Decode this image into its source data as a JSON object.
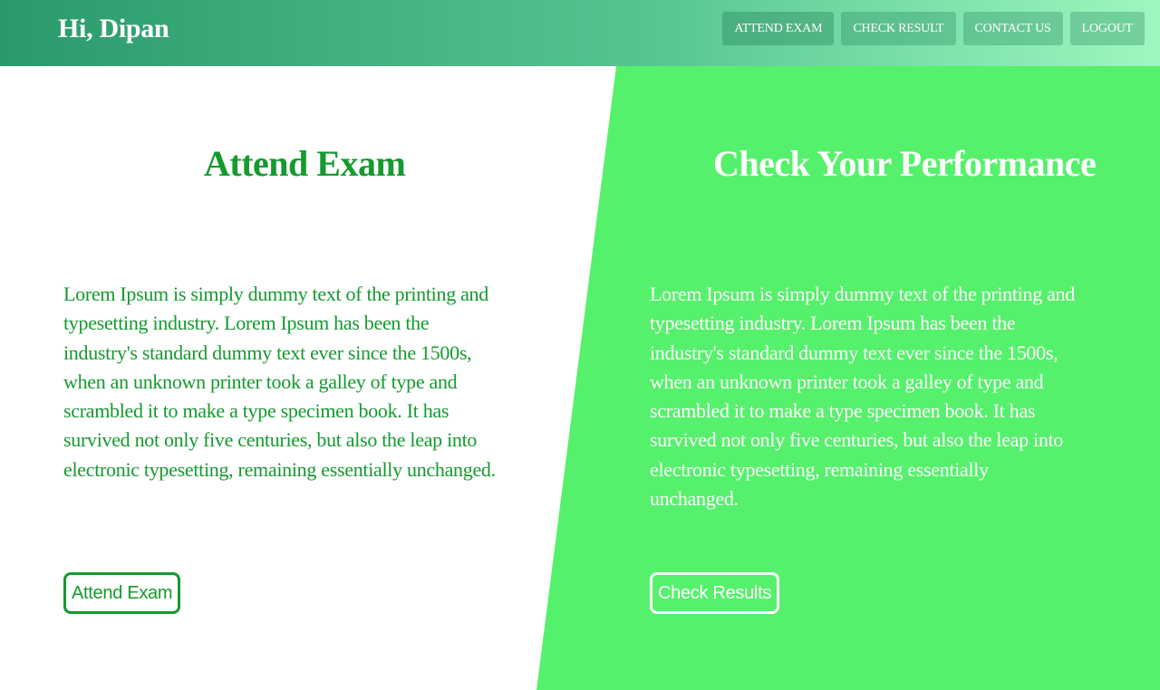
{
  "header": {
    "greeting": "Hi, Dipan",
    "nav": [
      {
        "label": "ATTEND EXAM"
      },
      {
        "label": "CHECK RESULT"
      },
      {
        "label": "CONTACT US"
      },
      {
        "label": "LOGOUT"
      }
    ]
  },
  "left": {
    "title": "Attend Exam",
    "text": "Lorem Ipsum is simply dummy text of the printing and typesetting industry. Lorem Ipsum has been the industry's standard dummy text ever since the 1500s, when an unknown printer took a galley of type and scrambled it to make a type specimen book. It has survived not only five centuries, but also the leap into electronic typesetting, remaining essentially unchanged.",
    "button": "Attend Exam"
  },
  "right": {
    "title": "Check Your Performance",
    "text": "Lorem Ipsum is simply dummy text of the printing and typesetting industry. Lorem Ipsum has been the industry's standard dummy text ever since the 1500s, when an unknown printer took a galley of type and scrambled it to make a type specimen book. It has survived not only five centuries, but also the leap into electronic typesetting, remaining essentially unchanged.",
    "button": "Check Results"
  },
  "colors": {
    "accent_green": "#149a2e",
    "panel_green": "#56f16c",
    "header_start": "#2a9a6b",
    "header_end": "#9ef7c0"
  }
}
